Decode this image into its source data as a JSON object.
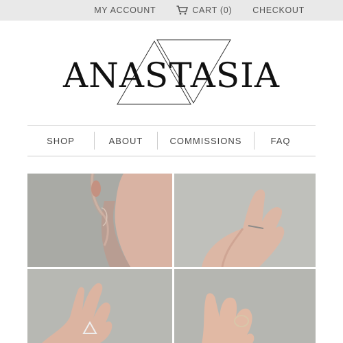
{
  "topbar": {
    "my_account": "MY ACCOUNT",
    "cart": "CART (0)",
    "checkout": "CHECKOUT"
  },
  "logo": {
    "text": "ANASTASIA"
  },
  "nav": {
    "items": [
      "SHOP",
      "ABOUT",
      "COMMISSIONS",
      "FAQ"
    ]
  },
  "products": [
    {
      "icon": "earring-photo"
    },
    {
      "icon": "thin-ring-photo"
    },
    {
      "icon": "triangle-ring-photo"
    },
    {
      "icon": "circle-ring-photo"
    }
  ],
  "colors": {
    "topbar_bg": "#e9e9e9",
    "logo": "#111111",
    "divider": "#cccccc"
  }
}
